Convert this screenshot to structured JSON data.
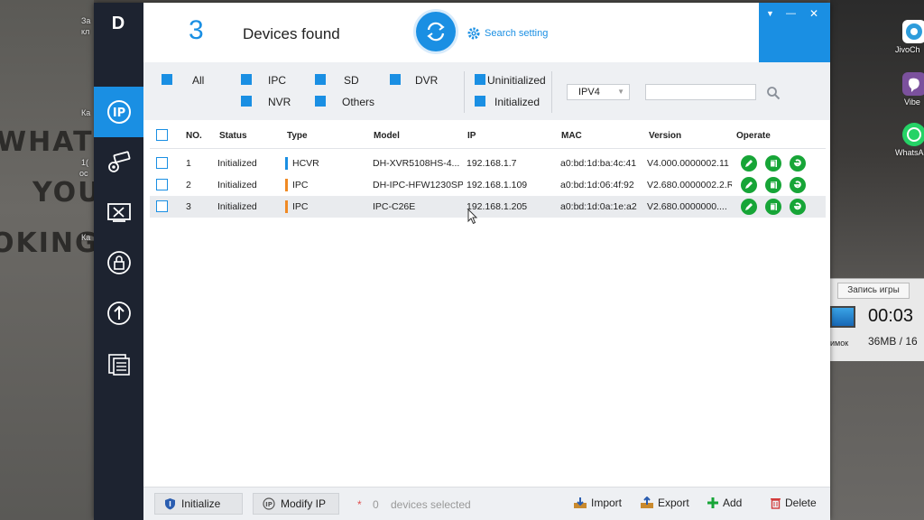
{
  "header": {
    "count": "3",
    "found_label": "Devices found",
    "search_setting": "Search setting"
  },
  "window": {
    "menu_glyph": "▼",
    "minimize_glyph": "—",
    "close_glyph": "✕"
  },
  "sidebar": {
    "logo": "D",
    "items": [
      {
        "icon": "ip-icon",
        "active": true
      },
      {
        "icon": "camera-settings-icon"
      },
      {
        "icon": "tools-icon"
      },
      {
        "icon": "lock-icon"
      },
      {
        "icon": "upgrade-icon"
      },
      {
        "icon": "document-icon"
      }
    ]
  },
  "filters": {
    "all": "All",
    "ipc": "IPC",
    "sd": "SD",
    "dvr": "DVR",
    "nvr": "NVR",
    "others": "Others",
    "uninitialized": "Uninitialized",
    "initialized": "Initialized",
    "ip_version": "IPV4",
    "search_value": ""
  },
  "table": {
    "headers": {
      "no": "NO.",
      "status": "Status",
      "type": "Type",
      "model": "Model",
      "ip": "IP",
      "mac": "MAC",
      "version": "Version",
      "operate": "Operate"
    },
    "rows": [
      {
        "no": "1",
        "status": "Initialized",
        "type": "HCVR",
        "type_color": "#1a8fe3",
        "model": "DH-XVR5108HS-4...",
        "ip": "192.168.1.7",
        "mac": "a0:bd:1d:ba:4c:41",
        "version": "V4.000.0000002.11"
      },
      {
        "no": "2",
        "status": "Initialized",
        "type": "IPC",
        "type_color": "#f08a24",
        "model": "DH-IPC-HFW1230SP",
        "ip": "192.168.1.109",
        "mac": "a0:bd:1d:06:4f:92",
        "version": "V2.680.0000002.2.R"
      },
      {
        "no": "3",
        "status": "Initialized",
        "type": "IPC",
        "type_color": "#f08a24",
        "model": "IPC-C26E",
        "ip": "192.168.1.205",
        "mac": "a0:bd:1d:0a:1e:a2",
        "version": "V2.680.0000000...."
      }
    ]
  },
  "footer": {
    "initialize": "Initialize",
    "modify_ip": "Modify IP",
    "asterisk": "*",
    "selected_count": "0",
    "selected_label": "devices selected",
    "import": "Import",
    "export": "Export",
    "add": "Add",
    "delete": "Delete"
  },
  "desktop": {
    "wall_words": [
      "WHAT",
      "YOU",
      "OKING"
    ],
    "left_labels": [
      "За",
      "кл",
      "Ка",
      "1(",
      "ос",
      "Ка"
    ],
    "right_icons": [
      {
        "label": "JivoCh",
        "color": "#2d9cdb"
      },
      {
        "label": "Vibe",
        "color": "#7b519d"
      },
      {
        "label": "WhatsA",
        "color": "#25d366"
      }
    ],
    "recorder_tab": "Запись игры",
    "recorder_time": "00:03",
    "recorder_size": "36MB / 16",
    "recorder_caption": "имок"
  },
  "colors": {
    "accent": "#1a8fe3",
    "sidebar": "#1d2330",
    "operate_green": "#17a537",
    "filter_bg": "#eef0f3"
  }
}
